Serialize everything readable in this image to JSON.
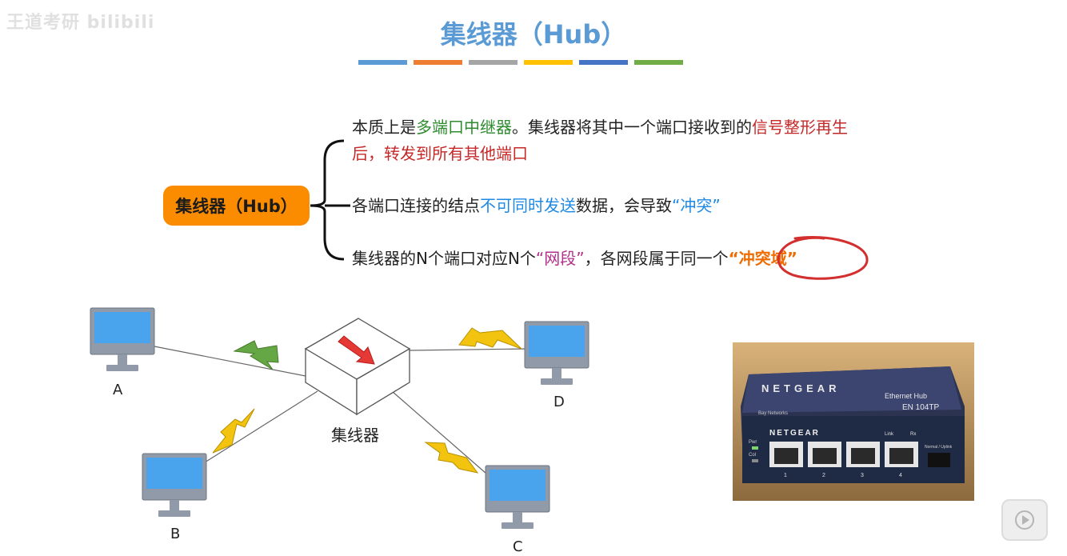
{
  "watermark": "王道考研 bilibili",
  "slide": {
    "title": "集线器（Hub）",
    "title_bar_colors": [
      "#5b9bd5",
      "#ed7d31",
      "#a5a5a5",
      "#ffc000",
      "#4472c4",
      "#70ad47"
    ]
  },
  "mindmap": {
    "root": "集线器（Hub）",
    "bullets": [
      {
        "parts": [
          {
            "text": "本质上是",
            "style": ""
          },
          {
            "text": "多端口中继器",
            "style": "g"
          },
          {
            "text": "。集线器将其中一个端口接收到的",
            "style": ""
          },
          {
            "text": "信号整形再生后，转发到所有其他端口",
            "style": "r"
          }
        ]
      },
      {
        "parts": [
          {
            "text": "各端口连接的结点",
            "style": ""
          },
          {
            "text": "不可同时发送",
            "style": "b"
          },
          {
            "text": "数据，会导致",
            "style": ""
          },
          {
            "text": "“冲突”",
            "style": "b"
          }
        ]
      },
      {
        "parts": [
          {
            "text": "集线器的N个端口对应N个",
            "style": ""
          },
          {
            "text": "“网段”",
            "style": "p"
          },
          {
            "text": "，各网段属于同一个",
            "style": ""
          },
          {
            "text": "“冲突域”",
            "style": "o"
          }
        ]
      }
    ]
  },
  "diagram": {
    "hub_label": "集线器",
    "nodes": [
      {
        "label": "A"
      },
      {
        "label": "B"
      },
      {
        "label": "C"
      },
      {
        "label": "D"
      }
    ]
  },
  "photo": {
    "brand": "NETGEAR",
    "product_text": "Ethernet Hub",
    "model_text": "EN 104TP",
    "sub_brand": "Bay Networks",
    "port_numbers": [
      "1",
      "2",
      "3",
      "4"
    ],
    "led_labels": [
      "Pwr",
      "Col"
    ],
    "header_labels": [
      "Link",
      "Rx"
    ],
    "uplink_label": "Normal / Uplink"
  },
  "player": {
    "icon": "play-icon"
  }
}
